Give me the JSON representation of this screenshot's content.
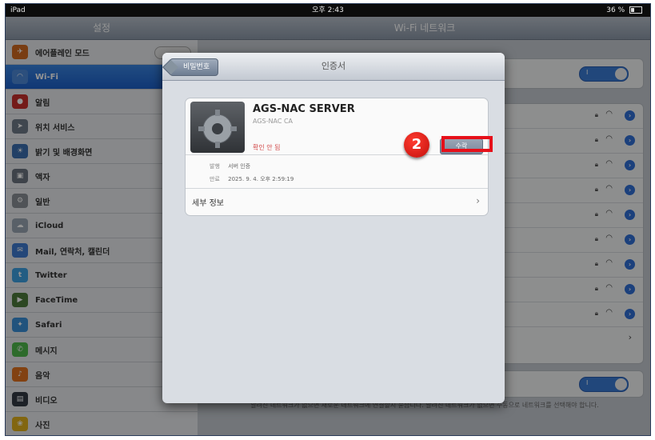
{
  "status_bar": {
    "device": "iPad",
    "time": "오후 2:43",
    "battery": "36 %"
  },
  "sidebar": {
    "title": "설정",
    "items": [
      {
        "label": "에어플레인 모드",
        "icon": "airplane-icon",
        "color": "#d06a1f"
      },
      {
        "label": "Wi-Fi",
        "icon": "wifi-icon",
        "color": "#4c89d8"
      },
      {
        "label": "알림",
        "icon": "notifications-icon",
        "color": "#c9302c"
      },
      {
        "label": "위치 서비스",
        "icon": "location-icon",
        "color": "#6f7a88"
      },
      {
        "label": "밝기 및 배경화면",
        "icon": "brightness-icon",
        "color": "#3c6fb0"
      },
      {
        "label": "액자",
        "icon": "picture-frame-icon",
        "color": "#6b7480"
      },
      {
        "label": "일반",
        "icon": "gear-icon",
        "color": "#8a8f96"
      },
      {
        "label": "iCloud",
        "icon": "cloud-icon",
        "color": "#9aa5b3"
      },
      {
        "label": "Mail, 연락처, 캘린더",
        "icon": "mail-icon",
        "color": "#3f7bd0"
      },
      {
        "label": "Twitter",
        "icon": "twitter-icon",
        "color": "#3da1e2"
      },
      {
        "label": "FaceTime",
        "icon": "facetime-icon",
        "color": "#4d7a3c"
      },
      {
        "label": "Safari",
        "icon": "compass-icon",
        "color": "#3a8fd8"
      },
      {
        "label": "메시지",
        "icon": "message-icon",
        "color": "#4fb84a"
      },
      {
        "label": "음악",
        "icon": "music-icon",
        "color": "#e0731f"
      },
      {
        "label": "비디오",
        "icon": "video-icon",
        "color": "#333a44"
      },
      {
        "label": "사진",
        "icon": "photos-icon",
        "color": "#e1b01d"
      }
    ]
  },
  "right_pane": {
    "title": "Wi-Fi 네트워크",
    "toggle_label": "I",
    "footer": "알려진 네트워크가 없으면 새로운 네트워크에 연결할지 묻습니다. 알려진 네트워크가 없으면 수동으로 네트워크를 선택해야 합니다."
  },
  "modal": {
    "back_label": "비밀번호",
    "title": "인증서",
    "cert_name": "AGS-NAC SERVER",
    "cert_issuer": "AGS-NAC CA",
    "cert_status": "확인 안 됨",
    "install_label": "수락",
    "details": [
      {
        "key": "발행",
        "value": "서버 인증"
      },
      {
        "key": "만료",
        "value": "2025. 9. 4. 오후 2:59:19"
      }
    ],
    "more_label": "세부 정보",
    "more_chevron": "›"
  },
  "annotation": {
    "step": "2",
    "color": "#e6101a"
  }
}
